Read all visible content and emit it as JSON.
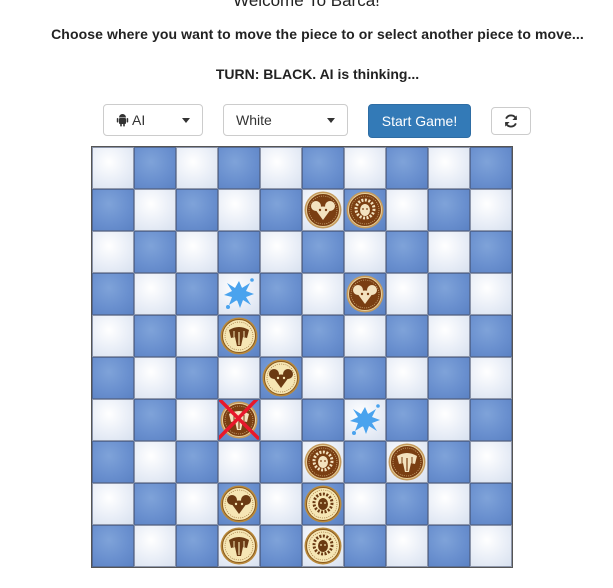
{
  "header": {
    "title": "Welcome To Barca!",
    "subtitle": "Choose where you want to move the piece to or select another piece to move...",
    "turn_status": "TURN: BLACK. AI is thinking..."
  },
  "controls": {
    "opponent_select": {
      "value": "AI",
      "icon": "android-icon"
    },
    "color_select": {
      "value": "White"
    },
    "start_button": "Start Game!",
    "refresh_icon": "refresh-icon"
  },
  "colors": {
    "accent": "#337ab7",
    "light_square": "#e9eef7",
    "dark_square": "#6a90cf",
    "black_piece": "#7a3e12",
    "white_piece": "#f6e6b4",
    "water": "#4aa3ee",
    "mark": "#e8182b"
  },
  "board": {
    "size": 10,
    "water_holes": [
      {
        "row": 3,
        "col": 3
      },
      {
        "row": 6,
        "col": 6
      }
    ],
    "pieces": [
      {
        "row": 1,
        "col": 5,
        "side": "black",
        "animal": "mouse"
      },
      {
        "row": 1,
        "col": 6,
        "side": "black",
        "animal": "lion"
      },
      {
        "row": 3,
        "col": 6,
        "side": "black",
        "animal": "mouse"
      },
      {
        "row": 4,
        "col": 3,
        "side": "white",
        "animal": "elephant"
      },
      {
        "row": 5,
        "col": 4,
        "side": "white",
        "animal": "mouse"
      },
      {
        "row": 6,
        "col": 3,
        "side": "black",
        "animal": "elephant",
        "marked": true
      },
      {
        "row": 7,
        "col": 5,
        "side": "black",
        "animal": "lion"
      },
      {
        "row": 7,
        "col": 7,
        "side": "black",
        "animal": "elephant"
      },
      {
        "row": 8,
        "col": 3,
        "side": "white",
        "animal": "mouse"
      },
      {
        "row": 8,
        "col": 5,
        "side": "white",
        "animal": "lion"
      },
      {
        "row": 9,
        "col": 3,
        "side": "white",
        "animal": "elephant"
      },
      {
        "row": 9,
        "col": 5,
        "side": "white",
        "animal": "lion"
      }
    ]
  }
}
